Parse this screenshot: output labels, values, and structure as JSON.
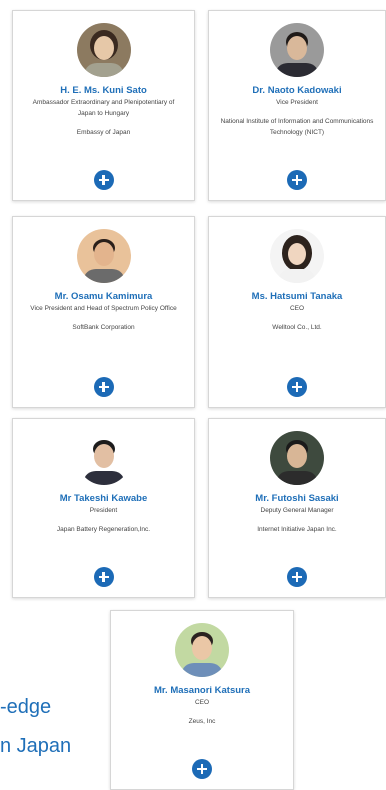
{
  "cards": [
    {
      "name": "H. E. Ms. Kuni Sato",
      "role": "Ambassador Extraordinary and Plenipotentiary of Japan to Hungary",
      "org": "Embassy of Japan",
      "avatar_bg": "#8c7a60",
      "skin": "#e6c8a8",
      "hair": "#3a2a20",
      "shirt": "#a3a18f"
    },
    {
      "name": "Dr. Naoto Kadowaki",
      "role": "Vice President",
      "org": "National Institute of Information and Communications Technology (NICT)",
      "avatar_bg": "#9a9a9a",
      "skin": "#d9b89a",
      "hair": "#1f1a18",
      "shirt": "#2b2b33"
    },
    {
      "name": "Mr. Osamu Kamimura",
      "role": "Vice President and Head of Spectrum Policy Office",
      "org": "SoftBank Corporation",
      "avatar_bg": "#e9c29a",
      "skin": "#e3b48d",
      "hair": "#2a1f1a",
      "shirt": "#6b6b6b"
    },
    {
      "name": "Ms. Hatsumi Tanaka",
      "role": "CEO",
      "org": "Welltool Co., Ltd.",
      "avatar_bg": "#f4f4f4",
      "skin": "#f0d6c0",
      "hair": "#2d231d",
      "shirt": "#f2f2f2"
    },
    {
      "name": "Mr Takeshi Kawabe",
      "role": "President",
      "org": "Japan Battery Regeneration,Inc.",
      "avatar_bg": "#ffffff",
      "skin": "#e2bfa3",
      "hair": "#1c1c1c",
      "shirt": "#2d2f3c"
    },
    {
      "name": "Mr. Futoshi Sasaki",
      "role": "Deputy General Manager",
      "org": "Internet Initiative Japan Inc.",
      "avatar_bg": "#3e4a3e",
      "skin": "#d8b696",
      "hair": "#1a1a1a",
      "shirt": "#2c2c2c"
    },
    {
      "name": "Mr. Masanori Katsura",
      "role": "CEO",
      "org": "Zeus, Inc",
      "avatar_bg": "#c2d9a2",
      "skin": "#eac7a6",
      "hair": "#2a2220",
      "shirt": "#6e8fb9"
    }
  ],
  "side_text": {
    "line1": "-edge",
    "line2": "n Japan"
  },
  "colors": {
    "accent": "#1f6fb8",
    "button": "#1c6ab6"
  },
  "icons": {
    "expand": "plus-circle-icon"
  }
}
